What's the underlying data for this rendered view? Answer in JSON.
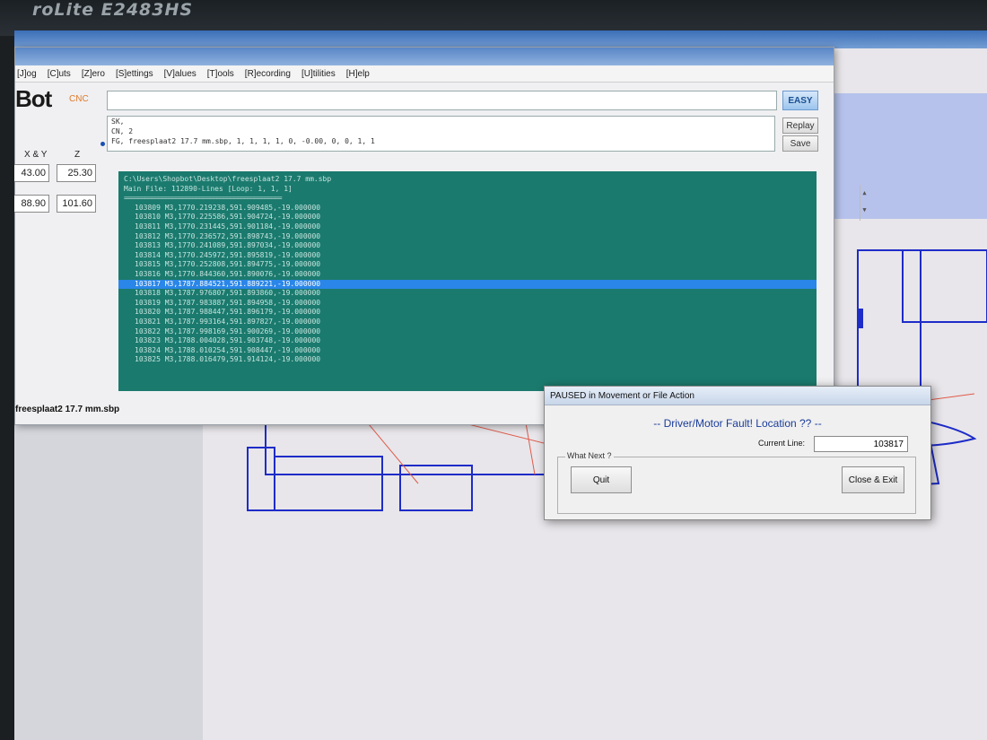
{
  "monitor": {
    "brand": "roLite E2483HS"
  },
  "menu": [
    "[J]og",
    "[C]uts",
    "[Z]ero",
    "[S]ettings",
    "[V]alues",
    "[T]ools",
    "[R]ecording",
    "[U]tilities",
    "[H]elp"
  ],
  "logo": {
    "text": "Bot",
    "sub": "CNC"
  },
  "command": {
    "easy_label": "EASY",
    "history": [
      "SK,",
      "CN, 2",
      "FG, freesplaat2 17.7 mm.sbp, 1, 1, 1, 1, 0, -0.00, 0, 0, 1, 1"
    ]
  },
  "buttons": {
    "replay": "Replay",
    "save": "Save"
  },
  "dro": {
    "xy_label": "X & Y",
    "z_label": "Z",
    "x": "43.00",
    "z": "25.30",
    "y": "88.90",
    "z2": "101.60"
  },
  "file_panel": {
    "path": "C:\\Users\\Shopbot\\Desktop\\freesplaat2 17.7 mm.sbp",
    "main_file": "Main File:  112890-Lines [Loop: 1, 1, 1]",
    "separator": "==============================================",
    "lines": [
      "103809 M3,1770.219238,591.909485,-19.000000",
      "103810 M3,1770.225586,591.904724,-19.000000",
      "103811 M3,1770.231445,591.901184,-19.000000",
      "103812 M3,1770.236572,591.898743,-19.000000",
      "103813 M3,1770.241089,591.897034,-19.000000",
      "103814 M3,1770.245972,591.895819,-19.000000",
      "103815 M3,1770.252808,591.894775,-19.000000",
      "103816 M3,1770.844360,591.890076,-19.000000",
      "103817 M3,1787.884521,591.889221,-19.000000",
      "103818 M3,1787.976807,591.893860,-19.000000",
      "103819 M3,1787.983887,591.894958,-19.000000",
      "103820 M3,1787.988447,591.896179,-19.000000",
      "103821 M3,1787.993164,591.897827,-19.000000",
      "103822 M3,1787.998169,591.900269,-19.000000",
      "103823 M3,1788.004028,591.903748,-19.000000",
      "103824 M3,1788.010254,591.908447,-19.000000",
      "103825 M3,1788.016479,591.914124,-19.000000"
    ],
    "highlight_index": 8
  },
  "status": {
    "filename": "freesplaat2 17.7 mm.sbp"
  },
  "dialog": {
    "title": "PAUSED in Movement or File Action",
    "message": "-- Driver/Motor Fault! Location ?? --",
    "current_line_label": "Current Line:",
    "current_line_value": "103817",
    "group_label": "What Next ?",
    "quit_label": "Quit",
    "close_label": "Close & Exit"
  },
  "colors": {
    "path": "#1e2cc8",
    "travel": "#e05a4a",
    "panel": "#1b7a6e",
    "highlight": "#2a86e8"
  }
}
